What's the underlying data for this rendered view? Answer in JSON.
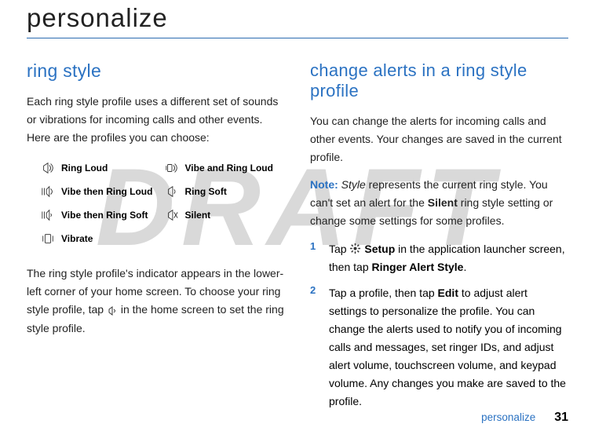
{
  "watermark": "DRAFT",
  "page_title": "personalize",
  "left": {
    "heading": "ring style",
    "intro": "Each ring style profile uses a different set of sounds or vibrations for incoming calls and other events. Here are the profiles you can choose:",
    "profiles": [
      {
        "icon": "ring-loud-icon",
        "label": "Ring Loud"
      },
      {
        "icon": "vibe-ring-loud-icon",
        "label": "Vibe and Ring Loud"
      },
      {
        "icon": "vibe-then-ring-loud-icon",
        "label": "Vibe then Ring Loud"
      },
      {
        "icon": "ring-soft-icon",
        "label": "Ring Soft"
      },
      {
        "icon": "vibe-then-ring-soft-icon",
        "label": "Vibe then Ring Soft"
      },
      {
        "icon": "silent-icon",
        "label": "Silent"
      },
      {
        "icon": "vibrate-icon",
        "label": "Vibrate"
      }
    ],
    "para2_a": "The ring style profile's indicator appears in the lower-left corner of your home screen. To choose your ring style profile, tap ",
    "para2_b": " in the home screen to set the ring style profile."
  },
  "right": {
    "heading": "change alerts in a ring style profile",
    "intro": "You can change the alerts for incoming calls and other events. Your changes are saved in the current profile.",
    "note_label": "Note:",
    "note_a": " ",
    "note_style": "Style",
    "note_b": " represents the current ring style. You can't set an alert for the ",
    "note_silent": "Silent",
    "note_c": " ring style setting or change some settings for some profiles.",
    "steps": [
      {
        "num": "1",
        "a": "Tap ",
        "setup": "Setup",
        "b": " in the application launcher screen, then tap ",
        "ringer": "Ringer Alert Style",
        "c": "."
      },
      {
        "num": "2",
        "a": "Tap a profile, then tap ",
        "edit": "Edit",
        "b": " to adjust alert settings to personalize the profile. You can change the alerts used to notify you of incoming calls and messages, set ringer IDs, and adjust alert volume, touchscreen volume, and keypad volume. Any changes you make are saved to the profile."
      }
    ]
  },
  "footer": {
    "label": "personalize",
    "page": "31"
  }
}
